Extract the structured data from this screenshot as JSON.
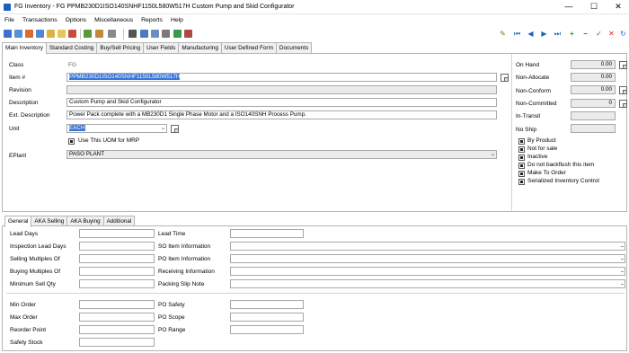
{
  "window": {
    "title": "FG Inventory - FG PPMB230D1ISO140SNHF1150L580W517H Custom Pump and Skid Configurator",
    "minimize": "—",
    "maximize": "☐",
    "close": "✕"
  },
  "menu": [
    "File",
    "Transactions",
    "Options",
    "Miscellaneous",
    "Reports",
    "Help"
  ],
  "main_tabs": [
    "Main Inventory",
    "Standard Costing",
    "Buy/Sell Pricing",
    "User Fields",
    "Manufacturing",
    "User Defined Form",
    "Documents"
  ],
  "form": {
    "class_label": "Class",
    "class_value": "FG",
    "item_label": "Item #",
    "item_value": "PPMB230D1ISO140SNHF1150L580W517H",
    "revision_label": "Revision",
    "revision_value": "",
    "description_label": "Description",
    "description_value": "Custom Pump and Skid Configurator",
    "ext_description_label": "Ext. Description",
    "ext_description_value": "Power Pack complete with a MB230D1 Single Phase Motor and a ISO140SNH Process Pump.",
    "unit_label": "Unit",
    "unit_value": "EACH",
    "use_uom_label": "Use This UOM for MRP",
    "eplant_label": "EPlant",
    "eplant_value": "PASO PLANT"
  },
  "stock": [
    {
      "label": "On Hand",
      "value": "0.00"
    },
    {
      "label": "Non-Allocate",
      "value": "0.00"
    },
    {
      "label": "Non-Conform",
      "value": "0.00"
    },
    {
      "label": "Non-Committed",
      "value": "0"
    },
    {
      "label": "In-Transit",
      "value": ""
    },
    {
      "label": "No Ship",
      "value": ""
    }
  ],
  "flags": [
    {
      "label": "By Product",
      "checked": true
    },
    {
      "label": "Not for sale",
      "checked": true
    },
    {
      "label": "Inactive",
      "checked": true
    },
    {
      "label": "Do not backflush this item",
      "checked": true
    },
    {
      "label": "Make To Order",
      "checked": true
    },
    {
      "label": "Serialized Inventory Control",
      "checked": true
    }
  ],
  "sub_tabs": [
    "General",
    "AKA Selling",
    "AKA Buying",
    "Additional"
  ],
  "general": {
    "lead_days": "Lead Days",
    "inspection_lead_days": "Inspection Lead Days",
    "selling_multiples": "Selling Multiples Of",
    "buying_multiples": "Buying Multiples Of",
    "minimum_sell_qty": "Minimum Sell Qty",
    "min_order": "Min Order",
    "max_order": "Max Order",
    "reorder_point": "Reorder Point",
    "safety_stock": "Safety Stock",
    "lead_time": "Lead Time",
    "so_item_info": "SO Item Information",
    "po_item_info": "PO Item Information",
    "receiving_info": "Receiving Information",
    "packing_slip_note": "Packing Slip Note",
    "po_safety": "PO Safety",
    "po_scope": "PO Scope",
    "po_range": "PO Range",
    "ellipsis": "..."
  }
}
